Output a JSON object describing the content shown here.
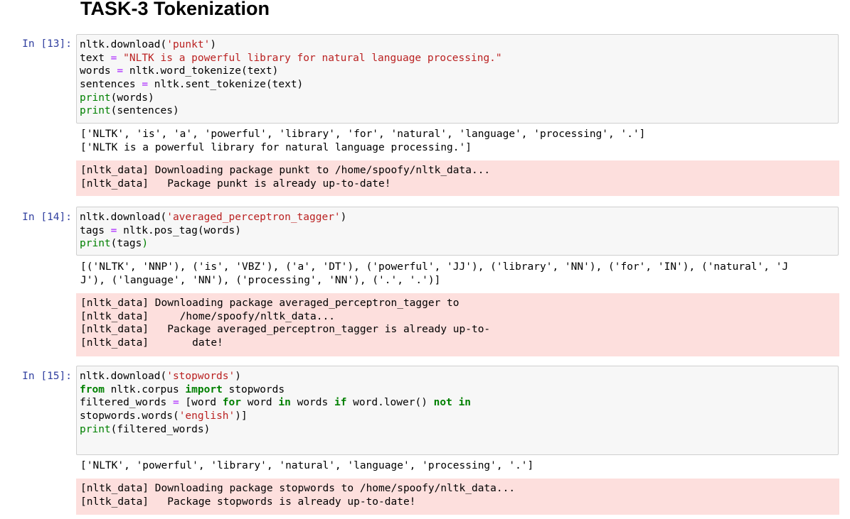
{
  "heading": "TASK-3 Tokenization",
  "cells": [
    {
      "prompt": "In [13]:",
      "code": [
        [
          {
            "t": "nltk.download("
          },
          {
            "t": "'punkt'",
            "c": "str"
          },
          {
            "t": ")"
          }
        ],
        [
          {
            "t": "text "
          },
          {
            "t": "=",
            "c": "op"
          },
          {
            "t": " "
          },
          {
            "t": "\"NLTK is a powerful library for natural language processing.\"",
            "c": "str"
          }
        ],
        [
          {
            "t": "words "
          },
          {
            "t": "=",
            "c": "op"
          },
          {
            "t": " nltk.word_tokenize(text)"
          }
        ],
        [
          {
            "t": "sentences "
          },
          {
            "t": "=",
            "c": "op"
          },
          {
            "t": " nltk.sent_tokenize(text)"
          }
        ],
        [
          {
            "t": "print",
            "c": "bi"
          },
          {
            "t": "(words)"
          }
        ],
        [
          {
            "t": "print",
            "c": "bi"
          },
          {
            "t": "(sentences)"
          }
        ]
      ],
      "stdout": [
        "['NLTK', 'is', 'a', 'powerful', 'library', 'for', 'natural', 'language', 'processing', '.']",
        "['NLTK is a powerful library for natural language processing.']"
      ],
      "stderr": [
        "[nltk_data] Downloading package punkt to /home/spoofy/nltk_data...",
        "[nltk_data]   Package punkt is already up-to-date!"
      ]
    },
    {
      "prompt": "In [14]:",
      "code": [
        [
          {
            "t": "nltk.download("
          },
          {
            "t": "'averaged_perceptron_tagger'",
            "c": "str"
          },
          {
            "t": ")"
          }
        ],
        [
          {
            "t": "tags "
          },
          {
            "t": "=",
            "c": "op"
          },
          {
            "t": " nltk.pos_tag(words)"
          }
        ],
        [
          {
            "t": "print",
            "c": "bi"
          },
          {
            "t": "(tags"
          },
          {
            "t": ")",
            "c": "bi"
          }
        ]
      ],
      "stdout": [
        "[('NLTK', 'NNP'), ('is', 'VBZ'), ('a', 'DT'), ('powerful', 'JJ'), ('library', 'NN'), ('for', 'IN'), ('natural', 'J",
        "J'), ('language', 'NN'), ('processing', 'NN'), ('.', '.')]"
      ],
      "stderr": [
        "[nltk_data] Downloading package averaged_perceptron_tagger to",
        "[nltk_data]     /home/spoofy/nltk_data...",
        "[nltk_data]   Package averaged_perceptron_tagger is already up-to-",
        "[nltk_data]       date!"
      ]
    },
    {
      "prompt": "In [15]:",
      "code": [
        [
          {
            "t": "nltk.download("
          },
          {
            "t": "'stopwords'",
            "c": "str"
          },
          {
            "t": ")"
          }
        ],
        [
          {
            "t": "from",
            "c": "kw"
          },
          {
            "t": " nltk.corpus "
          },
          {
            "t": "import",
            "c": "kw"
          },
          {
            "t": " stopwords"
          }
        ],
        [
          {
            "t": "filtered_words "
          },
          {
            "t": "=",
            "c": "op"
          },
          {
            "t": " [word "
          },
          {
            "t": "for",
            "c": "kw"
          },
          {
            "t": " word "
          },
          {
            "t": "in",
            "c": "kw"
          },
          {
            "t": " words "
          },
          {
            "t": "if",
            "c": "kw"
          },
          {
            "t": " word.lower() "
          },
          {
            "t": "not in",
            "c": "kw"
          }
        ],
        [
          {
            "t": "stopwords.words("
          },
          {
            "t": "'english'",
            "c": "str"
          },
          {
            "t": ")]"
          }
        ],
        [
          {
            "t": "print",
            "c": "bi"
          },
          {
            "t": "(filtered_words)"
          }
        ],
        [
          {
            "t": ""
          }
        ]
      ],
      "stdout": [
        "['NLTK', 'powerful', 'library', 'natural', 'language', 'processing', '.']"
      ],
      "stderr": [
        "[nltk_data] Downloading package stopwords to /home/spoofy/nltk_data...",
        "[nltk_data]   Package stopwords is already up-to-date!"
      ]
    }
  ]
}
